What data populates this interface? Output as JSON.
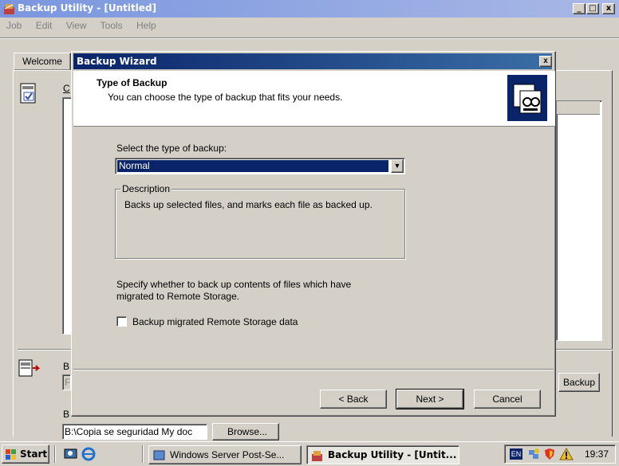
{
  "app": {
    "title": "Backup Utility - [Untitled]",
    "menu": [
      "Job",
      "Edit",
      "View",
      "Tools",
      "Help"
    ],
    "welcome_tab": "Welcome",
    "backup_button": "Backup",
    "dest_path": "B:\\Copia se seguridad My doc",
    "browse_button": "Browse...",
    "partial_labels": {
      "c": "C",
      "b1": "B",
      "b2": "B",
      "f": "F"
    }
  },
  "dialog": {
    "title": "Backup Wizard",
    "header_title": "Type of Backup",
    "header_subtitle": "You can choose the type of backup that fits your needs.",
    "select_label": "Select the type of backup:",
    "select_value": "Normal",
    "description_legend": "Description",
    "description_text": "Backs up selected files, and marks each file as backed up.",
    "migrate_text_line1": "Specify whether to back up contents of files which have",
    "migrate_text_line2": "migrated to Remote Storage.",
    "checkbox_label": "Backup migrated Remote Storage data",
    "checkbox_checked": false,
    "back_button": "< Back",
    "next_button": "Next >",
    "cancel_button": "Cancel"
  },
  "taskbar": {
    "start": "Start",
    "tasks": [
      "Windows Server Post-Se...",
      "Backup Utility - [Untit..."
    ],
    "lang": "EN",
    "clock": "19:37"
  }
}
